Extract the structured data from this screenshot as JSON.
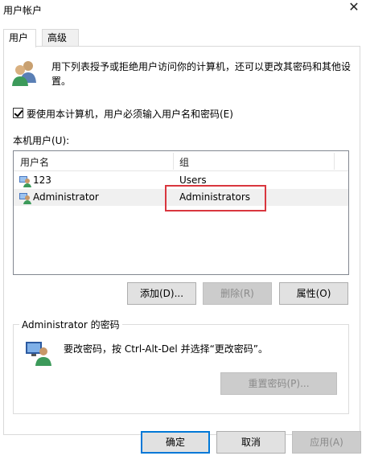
{
  "window": {
    "title": "用户帐户",
    "close_glyph": "✕"
  },
  "tabs": [
    {
      "label": "用户",
      "active": true
    },
    {
      "label": "高级",
      "active": false
    }
  ],
  "description": "用下列表授予或拒绝用户访问你的计算机，还可以更改其密码和其他设置。",
  "require_login": {
    "label": "要使用本计算机，用户必须输入用户名和密码(E)",
    "checked": true
  },
  "local_users": {
    "label": "本机用户(U):",
    "columns": [
      "用户名",
      "组"
    ],
    "rows": [
      {
        "name": "123",
        "group": "Users",
        "selected": false
      },
      {
        "name": "Administrator",
        "group": "Administrators",
        "selected": true
      }
    ]
  },
  "user_buttons": {
    "add": "添加(D)...",
    "remove": "删除(R)",
    "properties": "属性(O)"
  },
  "password_group": {
    "title": "Administrator 的密码",
    "text": "要改密码，按 Ctrl-Alt-Del 并选择“更改密码”。",
    "reset_button": "重置密码(P)..."
  },
  "dialog_buttons": {
    "ok": "确定",
    "cancel": "取消",
    "apply": "应用(A)"
  },
  "colors": {
    "highlight_border": "#d9363e",
    "default_button_border": "#0078d7",
    "selected_row": "#f0f0f0"
  }
}
